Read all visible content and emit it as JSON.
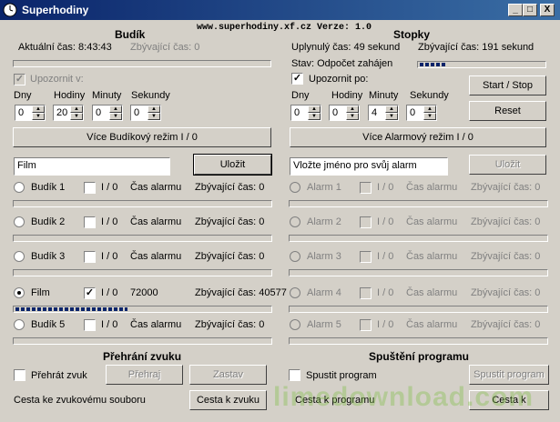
{
  "window": {
    "title": "Superhodiny",
    "subtitle": "www.superhodiny.xf.cz  Verze: 1.0",
    "minimize": "_",
    "maximize": "□",
    "close": "X"
  },
  "budik": {
    "heading": "Budík",
    "current_time": "Aktuální čas: 8:43:43",
    "remaining_time": "Zbývající čas: 0",
    "notify_label": "Upozornit v:",
    "col_labels": {
      "days": "Dny",
      "hours": "Hodiny",
      "minutes": "Minuty",
      "seconds": "Sekundy"
    },
    "spin_values": {
      "days": "0",
      "hours": "20",
      "minutes": "0",
      "seconds": "0"
    },
    "mode_button": "Více Budíkový režim I / 0",
    "name_input_value": "Film",
    "save_button": "Uložit",
    "alarms": [
      {
        "name": "Budík 1",
        "toggle": "I / 0",
        "time": "Čas alarmu",
        "remaining": "Zbývající čas: 0",
        "progress": 0
      },
      {
        "name": "Budík 2",
        "toggle": "I / 0",
        "time": "Čas alarmu",
        "remaining": "Zbývající čas: 0",
        "progress": 0
      },
      {
        "name": "Budík 3",
        "toggle": "I / 0",
        "time": "Čas alarmu",
        "remaining": "Zbývající čas: 0",
        "progress": 0
      },
      {
        "name": "Film",
        "toggle": "I / 0",
        "time": "72000",
        "remaining": "Zbývající čas: 40577",
        "progress": 0.44
      },
      {
        "name": "Budík 5",
        "toggle": "I / 0",
        "time": "Čas alarmu",
        "remaining": "Zbývající čas: 0",
        "progress": 0
      }
    ]
  },
  "stopky": {
    "heading": "Stopky",
    "elapsed": "Uplynulý čas: 49 sekund",
    "remaining": "Zbývající čas: 191 sekund",
    "state": "Stav: Odpočet zahájen",
    "state_progress": 0.2,
    "notify_label": "Upozornit po:",
    "col_labels": {
      "days": "Dny",
      "hours": "Hodiny",
      "minutes": "Minuty",
      "seconds": "Sekundy"
    },
    "spin_values": {
      "days": "0",
      "hours": "0",
      "minutes": "4",
      "seconds": "0"
    },
    "start_stop_button": "Start / Stop",
    "reset_button": "Reset",
    "mode_button": "Více Alarmový režim I / 0",
    "name_input_value": "Vložte jméno pro svůj alarm",
    "save_button": "Uložit",
    "alarms": [
      {
        "name": "Alarm 1",
        "toggle": "I / 0",
        "time": "Čas alarmu",
        "remaining": "Zbývající čas: 0"
      },
      {
        "name": "Alarm 2",
        "toggle": "I / 0",
        "time": "Čas alarmu",
        "remaining": "Zbývající čas: 0"
      },
      {
        "name": "Alarm 3",
        "toggle": "I / 0",
        "time": "Čas alarmu",
        "remaining": "Zbývající čas: 0"
      },
      {
        "name": "Alarm 4",
        "toggle": "I / 0",
        "time": "Čas alarmu",
        "remaining": "Zbývající čas: 0"
      },
      {
        "name": "Alarm 5",
        "toggle": "I / 0",
        "time": "Čas alarmu",
        "remaining": "Zbývající čas: 0"
      }
    ]
  },
  "sound": {
    "heading": "Přehrání zvuku",
    "play_checkbox": "Přehrát zvuk",
    "play_button": "Přehraj",
    "stop_button": "Zastav",
    "path_label": "Cesta ke zvukovému souboru",
    "path_button": "Cesta  k zvuku"
  },
  "program": {
    "heading": "Spuštění programu",
    "run_checkbox": "Spustit program",
    "run_button": "Spustit program",
    "path_label": "Cesta k programu",
    "path_button": "Cesta k"
  },
  "watermark": "limedownload.com"
}
